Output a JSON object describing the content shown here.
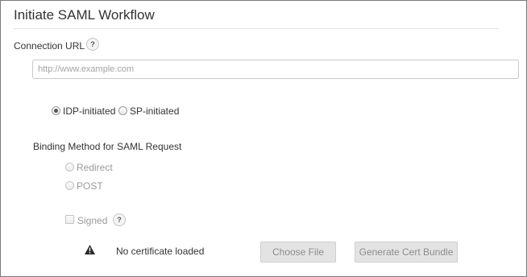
{
  "panel": {
    "title": "Initiate SAML Workflow"
  },
  "connection_url": {
    "label": "Connection URL",
    "help": "?",
    "placeholder": "http://www.example.com",
    "value": ""
  },
  "initiation": {
    "options": [
      {
        "label": "IDP-initiated",
        "selected": true
      },
      {
        "label": "SP-initiated",
        "selected": false
      }
    ]
  },
  "binding": {
    "label": "Binding Method for SAML Request",
    "options": [
      {
        "label": "Redirect",
        "selected": false,
        "enabled": false
      },
      {
        "label": "POST",
        "selected": false,
        "enabled": false
      }
    ],
    "signed_label": "Signed",
    "signed_checked": false,
    "signed_help": "?"
  },
  "certificate": {
    "icon": "warning-icon",
    "status": "No certificate loaded",
    "choose_file_label": "Choose File",
    "generate_label": "Generate Cert Bundle"
  },
  "colors": {
    "button_disabled_bg": "#e3e3e3",
    "button_disabled_text": "#8c8c8c",
    "border": "#7a7a7a"
  }
}
